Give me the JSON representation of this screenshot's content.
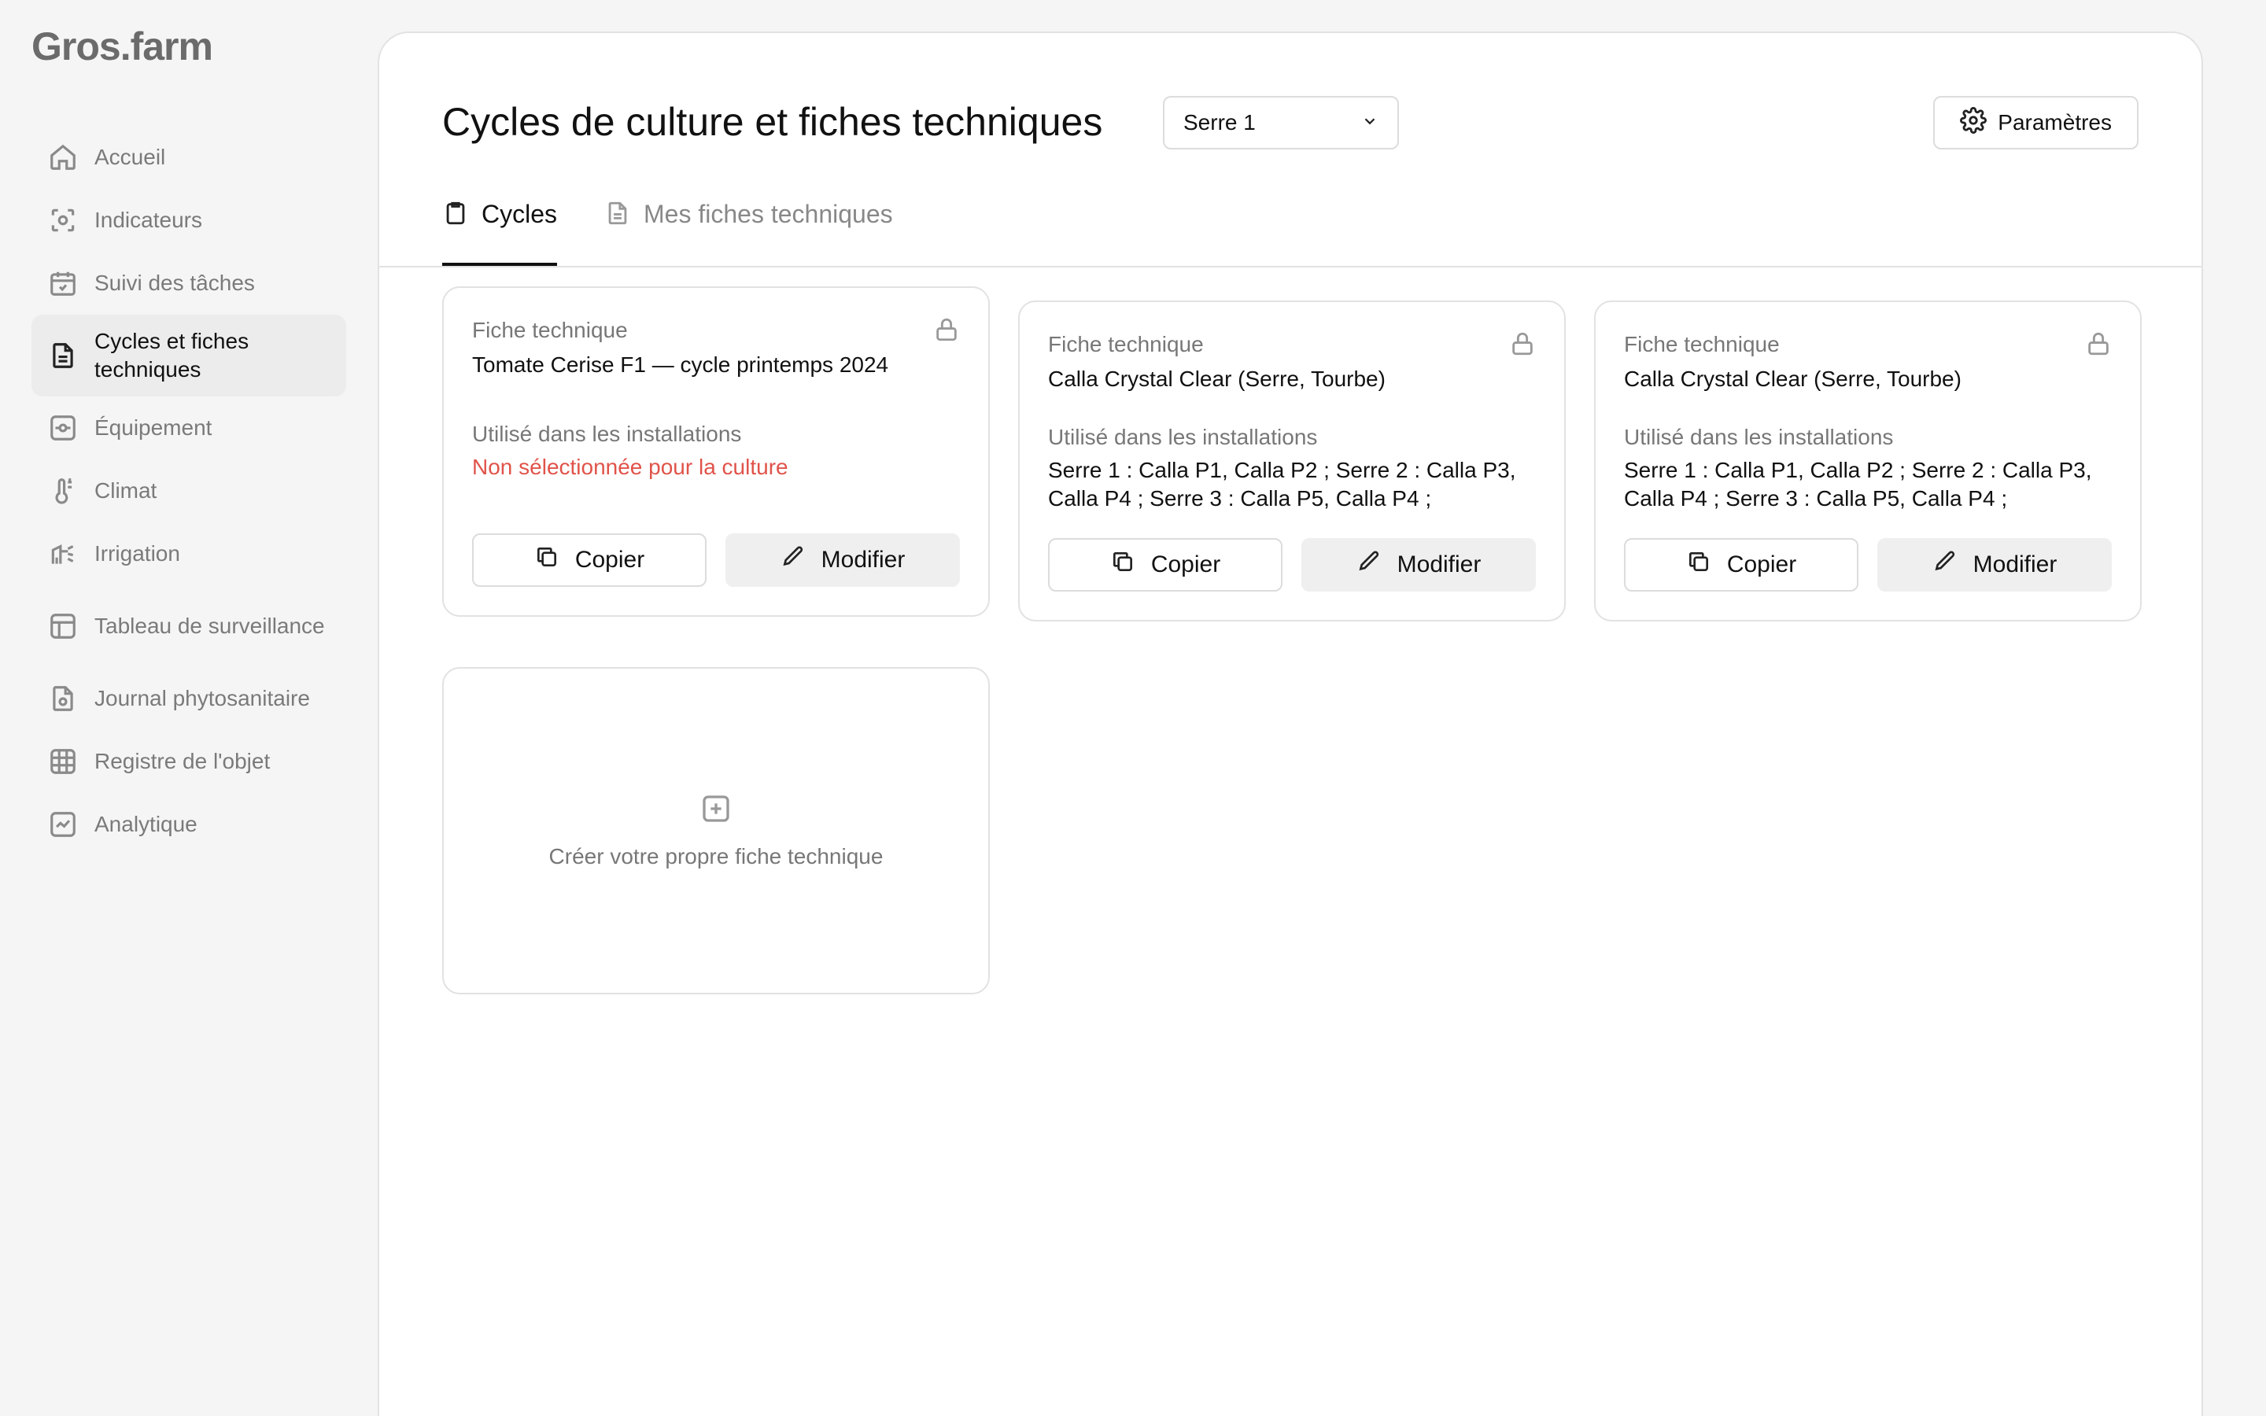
{
  "app": {
    "logo": "Gros.farm"
  },
  "sidebar": {
    "items": [
      {
        "label": "Accueil",
        "icon": "home-icon"
      },
      {
        "label": "Indicateurs",
        "icon": "indicators-icon"
      },
      {
        "label": "Suivi des tâches",
        "icon": "calendar-check-icon"
      },
      {
        "label": "Cycles et fiches techniques",
        "icon": "document-icon",
        "active": true
      },
      {
        "label": "Équipement",
        "icon": "equipment-icon"
      },
      {
        "label": "Climat",
        "icon": "thermometer-icon"
      },
      {
        "label": "Irrigation",
        "icon": "irrigation-icon"
      },
      {
        "label": "Tableau de surveillance",
        "icon": "grid-icon"
      },
      {
        "label": "Journal phytosanitaire",
        "icon": "journal-icon"
      },
      {
        "label": "Registre de l'objet",
        "icon": "table-icon"
      },
      {
        "label": "Analytique",
        "icon": "analytics-icon"
      }
    ]
  },
  "header": {
    "title": "Cycles de culture et fiches techniques",
    "greenhouse_select": "Serre 1",
    "settings_label": "Paramètres"
  },
  "tabs": [
    {
      "label": "Cycles",
      "active": true
    },
    {
      "label": "Mes fiches techniques",
      "active": false
    }
  ],
  "cards": [
    {
      "label": "Fiche technique",
      "name": "Tomate Cerise F1 — cycle printemps 2024",
      "usage_label": "Utilisé dans les installations",
      "usage_value": "Non sélectionnée pour la culture",
      "copy_label": "Copier",
      "edit_label": "Modifier"
    },
    {
      "label": "Fiche technique",
      "name": "Calla Crystal Clear (Serre, Tourbe)",
      "usage_label": "Utilisé dans les installations",
      "usage_value": "Serre 1 : Calla P1, Calla P2 ; Serre 2 : Calla P3, Calla P4 ; Serre 3 : Calla P5, Calla P4 ;",
      "copy_label": "Copier",
      "edit_label": "Modifier"
    },
    {
      "label": "Fiche technique",
      "name": "Calla Crystal Clear (Serre, Tourbe)",
      "usage_label": "Utilisé dans les installations",
      "usage_value": "Serre 1 : Calla P1, Calla P2 ; Serre 2 : Calla P3, Calla P4 ; Serre 3 : Calla P5, Calla P4 ;",
      "copy_label": "Copier",
      "edit_label": "Modifier"
    }
  ],
  "create_card": {
    "label": "Créer votre propre fiche technique"
  },
  "colors": {
    "warning": "#e0534a",
    "active_bg": "#ececec",
    "border": "#e2e2e2"
  }
}
